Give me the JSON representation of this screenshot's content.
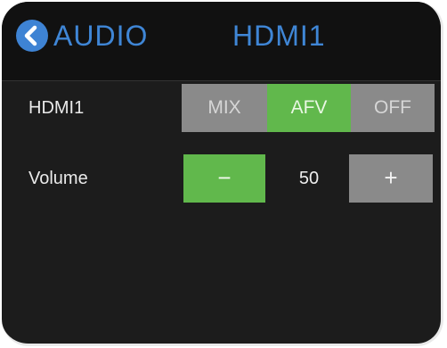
{
  "header": {
    "back_icon": "back-arrow-icon",
    "title": "AUDIO",
    "source": "HDMI1",
    "accent_color": "#3f86d6"
  },
  "audio_mode": {
    "label": "HDMI1",
    "options": [
      "MIX",
      "AFV",
      "OFF"
    ],
    "selected": "AFV",
    "active_color": "#61b84c",
    "inactive_color": "#8a8a8a"
  },
  "volume": {
    "label": "Volume",
    "minus_label": "−",
    "value": "50",
    "plus_label": "+"
  }
}
